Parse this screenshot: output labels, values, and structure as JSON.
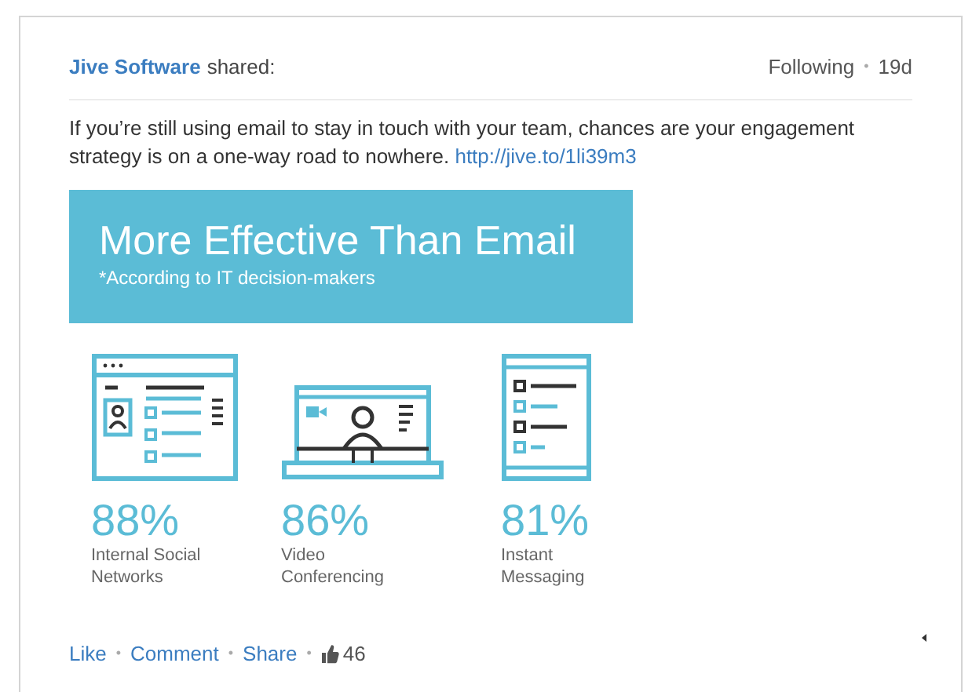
{
  "post": {
    "author": "Jive Software",
    "action": "shared:",
    "following": "Following",
    "separator": "•",
    "age": "19d",
    "body": "If you’re still using email to stay in touch with your team, chances are your engagement strategy is on a one-way road to nowhere.",
    "link": "http://jive.to/1li39m3"
  },
  "infographic": {
    "title": "More Effective Than Email",
    "subtitle": "*According to IT decision-makers",
    "stats": [
      {
        "kind": "social",
        "value": "88%",
        "label": "Internal Social Networks"
      },
      {
        "kind": "video",
        "value": "86%",
        "label": "Video Conferencing"
      },
      {
        "kind": "messaging",
        "value": "81%",
        "label": "Instant Messaging"
      }
    ]
  },
  "footer": [
    {
      "kind": "link",
      "text": "Like"
    },
    {
      "kind": "separator",
      "text": "•"
    },
    {
      "kind": "link",
      "text": "Comment"
    },
    {
      "kind": "separator",
      "text": "•"
    },
    {
      "kind": "link",
      "text": "Share"
    },
    {
      "kind": "separator",
      "text": "•"
    },
    {
      "kind": "likes",
      "text": "46"
    }
  ]
}
